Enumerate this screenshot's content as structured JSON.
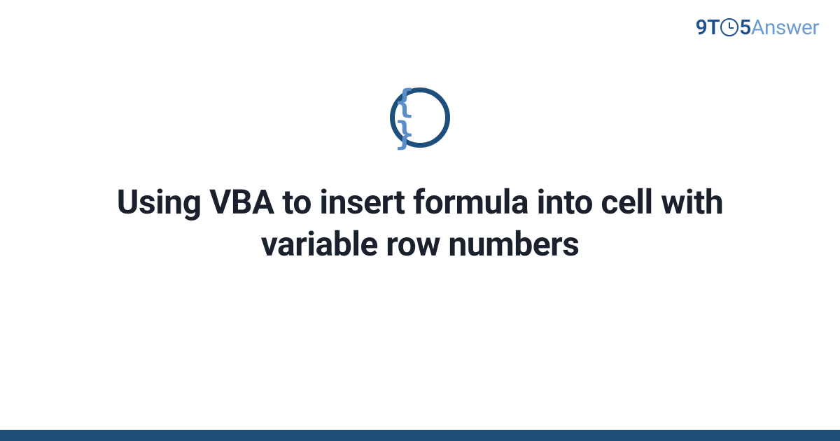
{
  "brand": {
    "part1": "9T",
    "part2": "5",
    "part3": "Answer"
  },
  "icon": {
    "name": "code-braces-icon",
    "glyph": "{ }"
  },
  "title": "Using VBA to insert formula into cell with variable row numbers"
}
